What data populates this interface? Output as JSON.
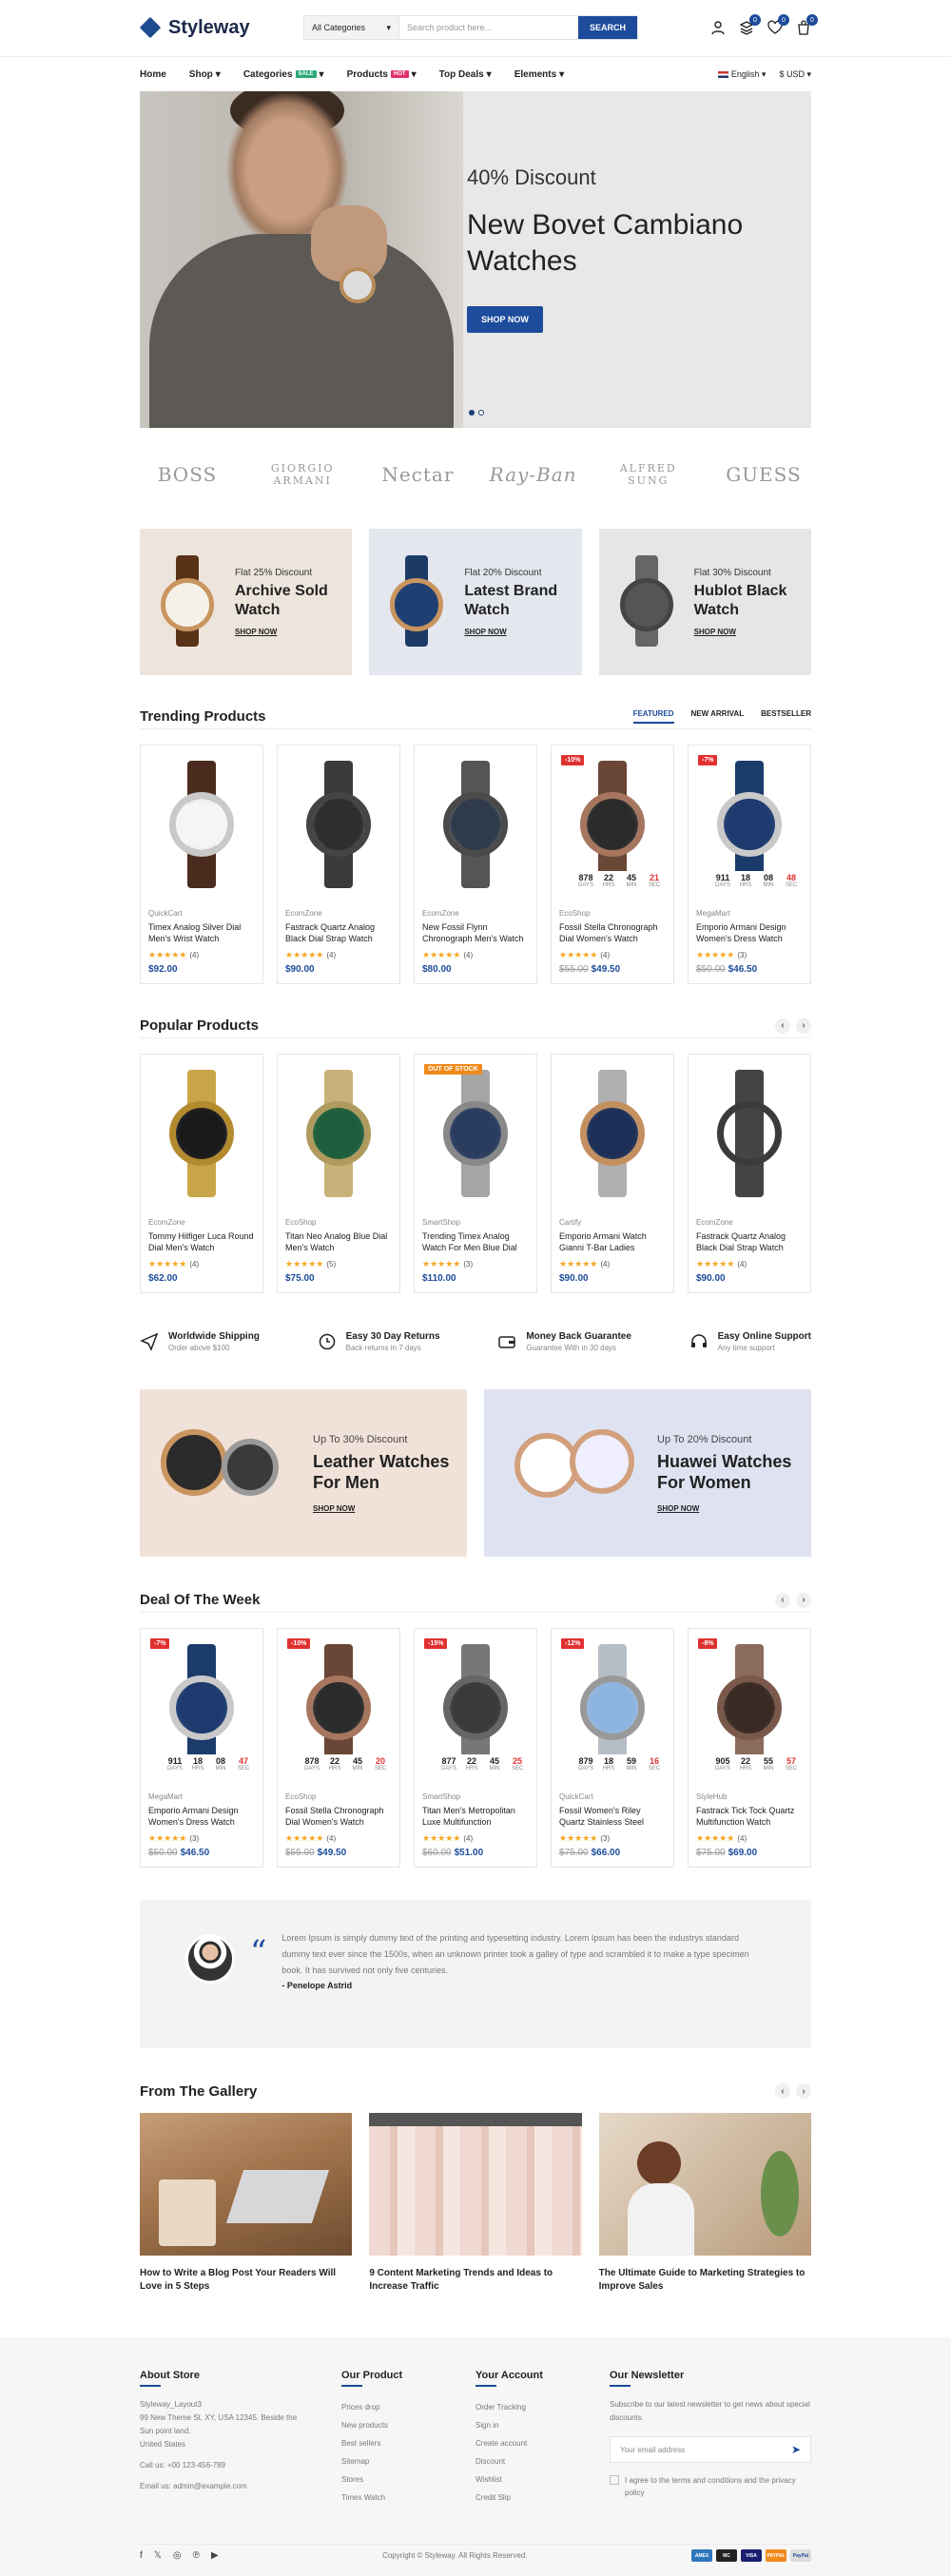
{
  "header": {
    "logo": "Styleway",
    "search_category": "All Categories",
    "search_placeholder": "Search product here...",
    "search_button": "SEARCH",
    "compare_count": "0",
    "wishlist_count": "0",
    "cart_count": "0"
  },
  "nav": {
    "items": [
      "Home",
      "Shop",
      "Categories",
      "Products",
      "Top Deals",
      "Elements"
    ],
    "categories_tag": "SALE",
    "products_tag": "HOT",
    "language": "English",
    "currency": "$ USD"
  },
  "hero": {
    "discount": "40% Discount",
    "title": "New Bovet Cambiano Watches",
    "button": "SHOP NOW"
  },
  "brands": [
    "BOSS",
    "GIORGIO ARMANI",
    "Nectar",
    "Ray-Ban",
    "ALFRED SUNG",
    "GUESS"
  ],
  "promos": [
    {
      "small": "Flat 25% Discount",
      "title": "Archive Sold Watch",
      "link": "SHOP NOW"
    },
    {
      "small": "Flat 20% Discount",
      "title": "Latest Brand Watch",
      "link": "SHOP NOW"
    },
    {
      "small": "Flat 30% Discount",
      "title": "Hublot Black Watch",
      "link": "SHOP NOW"
    }
  ],
  "trending": {
    "title": "Trending Products",
    "tabs": [
      "FEATURED",
      "NEW ARRIVAL",
      "BESTSELLER"
    ],
    "products": [
      {
        "vendor": "QuickCart",
        "name": "Timex Analog Silver Dial Men's Wrist Watch",
        "reviews": "(4)",
        "price": "$92.00",
        "old": "",
        "badge": "",
        "timer": null
      },
      {
        "vendor": "EcomZone",
        "name": "Fastrack Quartz Analog Black Dial Strap Watch",
        "reviews": "(4)",
        "price": "$90.00",
        "old": "",
        "badge": "",
        "timer": null
      },
      {
        "vendor": "EcomZone",
        "name": "New Fossil Flynn Chronograph Men's Watch",
        "reviews": "(4)",
        "price": "$80.00",
        "old": "",
        "badge": "",
        "timer": null
      },
      {
        "vendor": "EcoShop",
        "name": "Fossil Stella Chronograph Dial Women's Watch",
        "reviews": "(4)",
        "price": "$49.50",
        "old": "$55.00",
        "badge": "-10%",
        "timer": [
          "878",
          "22",
          "45",
          "21"
        ]
      },
      {
        "vendor": "MegaMart",
        "name": "Emporio Armani Design Women's Dress Watch",
        "reviews": "(3)",
        "price": "$46.50",
        "old": "$50.00",
        "badge": "-7%",
        "timer": [
          "911",
          "18",
          "08",
          "48"
        ]
      }
    ]
  },
  "popular": {
    "title": "Popular Products",
    "products": [
      {
        "vendor": "EcomZone",
        "name": "Tommy Hilfiger Luca Round Dial Men's Watch",
        "reviews": "(4)",
        "price": "$62.00",
        "old": "",
        "badge": ""
      },
      {
        "vendor": "EcoShop",
        "name": "Titan Neo Analog Blue Dial Men's Watch",
        "reviews": "(5)",
        "price": "$75.00",
        "old": "",
        "badge": ""
      },
      {
        "vendor": "SmartShop",
        "name": "Trending Timex Analog Watch For Men Blue Dial",
        "reviews": "(3)",
        "price": "$110.00",
        "old": "",
        "badge": "OUT OF STOCK"
      },
      {
        "vendor": "Cartify",
        "name": "Emporio Armani Watch Gianni T-Bar Ladies",
        "reviews": "(4)",
        "price": "$90.00",
        "old": "",
        "badge": ""
      },
      {
        "vendor": "EcomZone",
        "name": "Fastrack Quartz Analog Black Dial Strap Watch",
        "reviews": "(4)",
        "price": "$90.00",
        "old": "",
        "badge": ""
      }
    ]
  },
  "timer_labels": [
    "DAYS",
    "HRS",
    "MIN",
    "SEC"
  ],
  "services": [
    {
      "title": "Worldwide Shipping",
      "sub": "Order above $100"
    },
    {
      "title": "Easy 30 Day Returns",
      "sub": "Back returns in 7 days"
    },
    {
      "title": "Money Back Guarantee",
      "sub": "Guarantee With in 30 days"
    },
    {
      "title": "Easy Online Support",
      "sub": "Any time support"
    }
  ],
  "banners": [
    {
      "small": "Up To 30% Discount",
      "title": "Leather Watches For Men",
      "link": "SHOP NOW"
    },
    {
      "small": "Up To 20% Discount",
      "title": "Huawei Watches For Women",
      "link": "SHOP NOW"
    }
  ],
  "deal": {
    "title": "Deal Of The Week",
    "products": [
      {
        "vendor": "MegaMart",
        "name": "Emporio Armani Design Women's Dress Watch",
        "reviews": "(3)",
        "price": "$46.50",
        "old": "$50.00",
        "badge": "-7%",
        "timer": [
          "911",
          "18",
          "08",
          "47"
        ]
      },
      {
        "vendor": "EcoShop",
        "name": "Fossil Stella Chronograph Dial Women's Watch",
        "reviews": "(4)",
        "price": "$49.50",
        "old": "$55.00",
        "badge": "-10%",
        "timer": [
          "878",
          "22",
          "45",
          "20"
        ]
      },
      {
        "vendor": "SmartShop",
        "name": "Titan Men's Metropolitan Luxe Multifunction",
        "reviews": "(4)",
        "price": "$51.00",
        "old": "$60.00",
        "badge": "-15%",
        "timer": [
          "877",
          "22",
          "45",
          "25"
        ]
      },
      {
        "vendor": "QuickCart",
        "name": "Fossil Women's Riley Quartz Stainless Steel",
        "reviews": "(3)",
        "price": "$66.00",
        "old": "$75.00",
        "badge": "-12%",
        "timer": [
          "879",
          "18",
          "59",
          "16"
        ]
      },
      {
        "vendor": "StyleHub",
        "name": "Fastrack Tick Tock Quartz Multifunction Watch",
        "reviews": "(4)",
        "price": "$69.00",
        "old": "$75.00",
        "badge": "-8%",
        "timer": [
          "905",
          "22",
          "55",
          "57"
        ]
      }
    ]
  },
  "testimonial": {
    "text": "Lorem Ipsum is simply dummy text of the printing and typesetting industry. Lorem Ipsum has been the industrys standard dummy text ever since the 1500s, when an unknown printer took a galley of type and scrambled it to make a type specimen book. It has survived not only five centuries.",
    "author": "- Penelope Astrid"
  },
  "gallery": {
    "title": "From The Gallery",
    "posts": [
      "How to Write a Blog Post Your Readers Will Love in 5 Steps",
      "9 Content Marketing Trends and Ideas to Increase Traffic",
      "The Ultimate Guide to Marketing Strategies to Improve Sales"
    ]
  },
  "footer": {
    "about_title": "About Store",
    "about_lines": [
      "Styleway_Layout3",
      "99 New Theme St. XY, USA 12345. Beside the Sun point land.",
      "United States",
      "Call us: +00 123-456-789",
      "Email us: admin@example.com"
    ],
    "product_title": "Our Product",
    "product_links": [
      "Prices drop",
      "New products",
      "Best sellers",
      "Sitemap",
      "Stores",
      "Timex Watch"
    ],
    "account_title": "Your Account",
    "account_links": [
      "Order Tracking",
      "Sign in",
      "Create account",
      "Discount",
      "Wishlist",
      "Credit Slip"
    ],
    "newsletter_title": "Our Newsletter",
    "newsletter_text": "Subscribe to our latest newsletter to get news about special discounts.",
    "email_placeholder": "Your email address",
    "agree": "I agree to the terms and conditions and the privacy policy",
    "copyright": "Copyright © Styleway. All Rights Reserved.",
    "payments": [
      "AMEX",
      "MC",
      "VISA",
      "PAYPAL",
      "PayPal"
    ]
  },
  "colors": {
    "primary": "#1c4c9b",
    "sale_badge": "#e03131",
    "hot_tag": "#e1306c",
    "sale_tag": "#2aa876",
    "star": "#f5a623"
  }
}
